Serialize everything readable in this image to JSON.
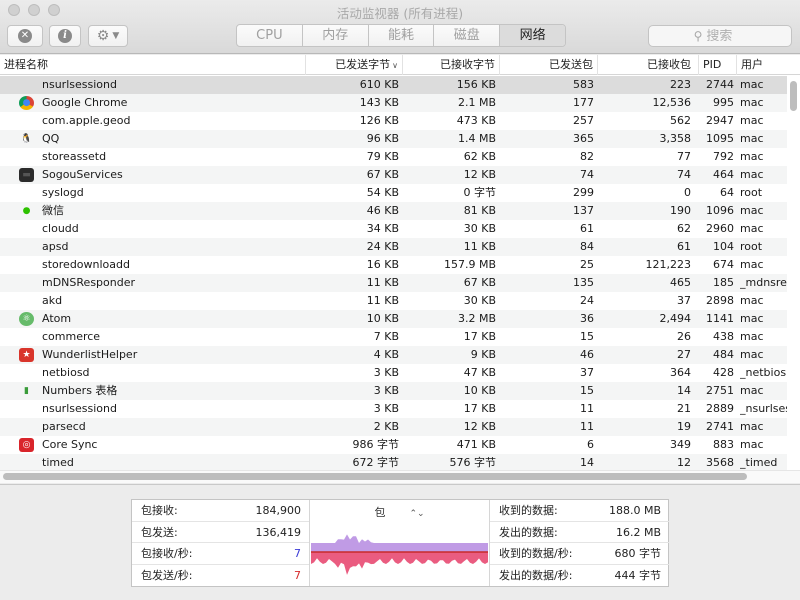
{
  "window": {
    "title": "活动监视器 (所有进程)"
  },
  "toolbar": {
    "close_glyph": "✕",
    "info_glyph": "i",
    "gear_glyph": "⚙",
    "tabs": [
      "CPU",
      "内存",
      "能耗",
      "磁盘",
      "网络"
    ],
    "active_tab": "网络",
    "search_placeholder": "搜索"
  },
  "table": {
    "columns": [
      "进程名称",
      "已发送字节",
      "已接收字节",
      "已发送包",
      "已接收包",
      "PID",
      "用户"
    ],
    "sort_column": "已发送字节",
    "sort_direction": "descending",
    "selected_row": 0,
    "rows": [
      {
        "name": "nsurlsessiond",
        "icon": "",
        "sent_bytes": "610 KB",
        "recv_bytes": "156 KB",
        "sent_packets": "583",
        "recv_packets": "223",
        "pid": "2744",
        "user": "mac"
      },
      {
        "name": "Google Chrome",
        "icon": "chrome-icon",
        "sent_bytes": "143 KB",
        "recv_bytes": "2.1 MB",
        "sent_packets": "177",
        "recv_packets": "12,536",
        "pid": "995",
        "user": "mac"
      },
      {
        "name": "com.apple.geod",
        "icon": "",
        "sent_bytes": "126 KB",
        "recv_bytes": "473 KB",
        "sent_packets": "257",
        "recv_packets": "562",
        "pid": "2947",
        "user": "mac"
      },
      {
        "name": "QQ",
        "icon": "qq-icon",
        "sent_bytes": "96 KB",
        "recv_bytes": "1.4 MB",
        "sent_packets": "365",
        "recv_packets": "3,358",
        "pid": "1095",
        "user": "mac"
      },
      {
        "name": "storeassetd",
        "icon": "",
        "sent_bytes": "79 KB",
        "recv_bytes": "62 KB",
        "sent_packets": "82",
        "recv_packets": "77",
        "pid": "792",
        "user": "mac"
      },
      {
        "name": "SogouServices",
        "icon": "sogou-icon",
        "sent_bytes": "67 KB",
        "recv_bytes": "12 KB",
        "sent_packets": "74",
        "recv_packets": "74",
        "pid": "464",
        "user": "mac"
      },
      {
        "name": "syslogd",
        "icon": "",
        "sent_bytes": "54 KB",
        "recv_bytes": "0 字节",
        "sent_packets": "299",
        "recv_packets": "0",
        "pid": "64",
        "user": "root"
      },
      {
        "name": "微信",
        "icon": "wechat-icon",
        "sent_bytes": "46 KB",
        "recv_bytes": "81 KB",
        "sent_packets": "137",
        "recv_packets": "190",
        "pid": "1096",
        "user": "mac"
      },
      {
        "name": "cloudd",
        "icon": "",
        "sent_bytes": "34 KB",
        "recv_bytes": "30 KB",
        "sent_packets": "61",
        "recv_packets": "62",
        "pid": "2960",
        "user": "mac"
      },
      {
        "name": "apsd",
        "icon": "",
        "sent_bytes": "24 KB",
        "recv_bytes": "11 KB",
        "sent_packets": "84",
        "recv_packets": "61",
        "pid": "104",
        "user": "root"
      },
      {
        "name": "storedownloadd",
        "icon": "",
        "sent_bytes": "16 KB",
        "recv_bytes": "157.9 MB",
        "sent_packets": "25",
        "recv_packets": "121,223",
        "pid": "674",
        "user": "mac"
      },
      {
        "name": "mDNSResponder",
        "icon": "",
        "sent_bytes": "11 KB",
        "recv_bytes": "67 KB",
        "sent_packets": "135",
        "recv_packets": "465",
        "pid": "185",
        "user": "_mdnsre"
      },
      {
        "name": "akd",
        "icon": "",
        "sent_bytes": "11 KB",
        "recv_bytes": "30 KB",
        "sent_packets": "24",
        "recv_packets": "37",
        "pid": "2898",
        "user": "mac"
      },
      {
        "name": "Atom",
        "icon": "atom-icon",
        "sent_bytes": "10 KB",
        "recv_bytes": "3.2 MB",
        "sent_packets": "36",
        "recv_packets": "2,494",
        "pid": "1141",
        "user": "mac"
      },
      {
        "name": "commerce",
        "icon": "",
        "sent_bytes": "7 KB",
        "recv_bytes": "17 KB",
        "sent_packets": "15",
        "recv_packets": "26",
        "pid": "438",
        "user": "mac"
      },
      {
        "name": "WunderlistHelper",
        "icon": "wunderlist-icon",
        "sent_bytes": "4 KB",
        "recv_bytes": "9 KB",
        "sent_packets": "46",
        "recv_packets": "27",
        "pid": "484",
        "user": "mac"
      },
      {
        "name": "netbiosd",
        "icon": "",
        "sent_bytes": "3 KB",
        "recv_bytes": "47 KB",
        "sent_packets": "37",
        "recv_packets": "364",
        "pid": "428",
        "user": "_netbios"
      },
      {
        "name": "Numbers 表格",
        "icon": "numbers-icon",
        "sent_bytes": "3 KB",
        "recv_bytes": "10 KB",
        "sent_packets": "15",
        "recv_packets": "14",
        "pid": "2751",
        "user": "mac"
      },
      {
        "name": "nsurlsessiond",
        "icon": "",
        "sent_bytes": "3 KB",
        "recv_bytes": "17 KB",
        "sent_packets": "11",
        "recv_packets": "21",
        "pid": "2889",
        "user": "_nsurlses"
      },
      {
        "name": "parsecd",
        "icon": "",
        "sent_bytes": "2 KB",
        "recv_bytes": "12 KB",
        "sent_packets": "11",
        "recv_packets": "19",
        "pid": "2741",
        "user": "mac"
      },
      {
        "name": "Core Sync",
        "icon": "coresync-icon",
        "sent_bytes": "986 字节",
        "recv_bytes": "471 KB",
        "sent_packets": "6",
        "recv_packets": "349",
        "pid": "883",
        "user": "mac"
      },
      {
        "name": "timed",
        "icon": "",
        "sent_bytes": "672 字节",
        "recv_bytes": "576 字节",
        "sent_packets": "14",
        "recv_packets": "12",
        "pid": "3568",
        "user": "_timed"
      }
    ]
  },
  "summary": {
    "packets_in_label": "包接收:",
    "packets_in": "184,900",
    "packets_out_label": "包发送:",
    "packets_out": "136,419",
    "packets_in_sec_label": "包接收/秒:",
    "packets_in_sec": "7",
    "packets_out_sec_label": "包发送/秒:",
    "packets_out_sec": "7",
    "graph_selector": "包",
    "data_received_label": "收到的数据:",
    "data_received": "188.0 MB",
    "data_sent_label": "发出的数据:",
    "data_sent": "16.2 MB",
    "data_received_sec_label": "收到的数据/秒:",
    "data_received_sec": "680 字节",
    "data_sent_sec_label": "发出的数据/秒:",
    "data_sent_sec": "444 字节"
  },
  "colors": {
    "received": "#3b3bd6",
    "sent": "#d62b2b",
    "received_fill": "#b58ae0",
    "sent_fill": "#e6406a"
  }
}
